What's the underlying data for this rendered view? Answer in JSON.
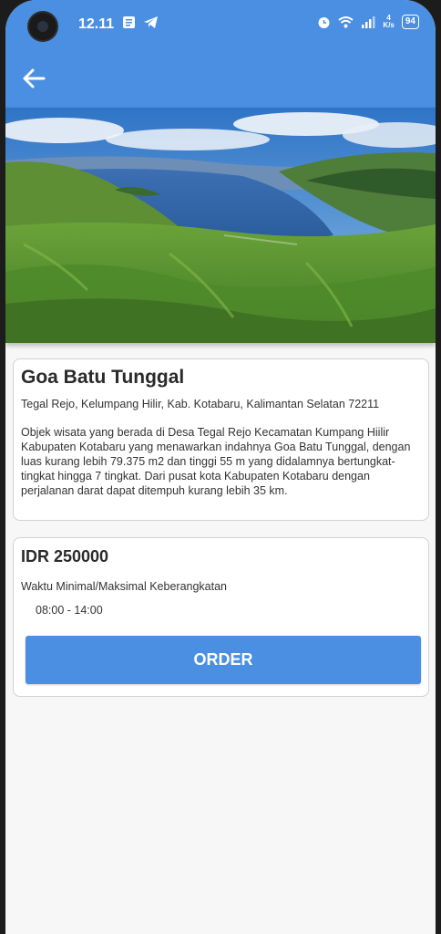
{
  "status_bar": {
    "time": "12.11",
    "net_speed_value": "4",
    "net_speed_unit": "K/s",
    "battery": "94"
  },
  "colors": {
    "primary": "#4a8fe2",
    "background": "#f7f7f7",
    "card_border": "#d2d2d2"
  },
  "destination": {
    "name": "Goa Batu Tunggal",
    "address": "Tegal Rejo, Kelumpang Hilir, Kab. Kotabaru, Kalimantan Selatan 72211",
    "description": "Objek wisata yang berada di Desa Tegal Rejo Kecamatan Kumpang Hiilir Kabupaten Kotabaru yang menawarkan indahnya Goa Batu Tunggal, dengan luas kurang lebih 79.375 m2 dan tinggi 55 m yang didalamnya bertungkat-tingkat hingga 7 tingkat. Dari pusat kota Kabupaten Kotabaru dengan perjalanan darat dapat ditempuh kurang lebih 35 km."
  },
  "booking": {
    "price": "IDR 250000",
    "time_label": "Waktu Minimal/Maksimal Keberangkatan",
    "time_value": "08:00 - 14:00",
    "order_label": "ORDER"
  }
}
